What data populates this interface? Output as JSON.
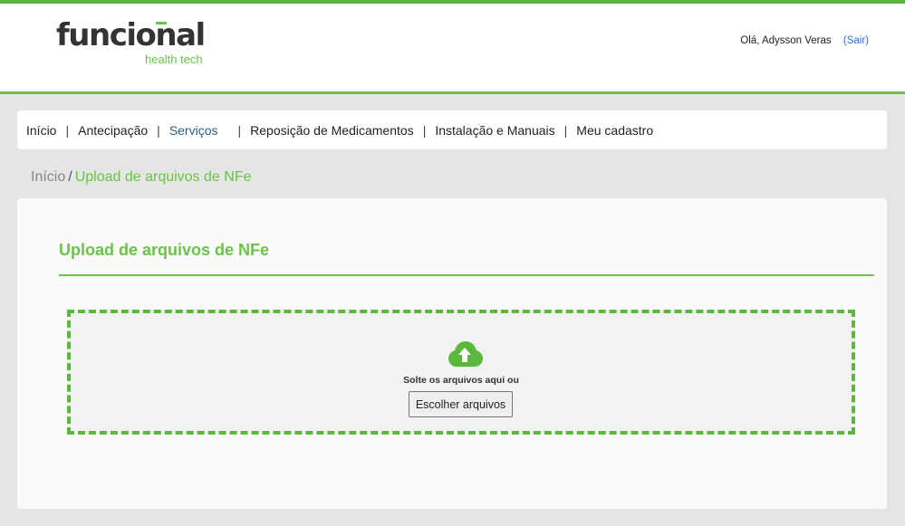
{
  "header": {
    "logo_main": "funcional",
    "logo_sub": "health tech",
    "greeting": "Olá, Adysson Veras",
    "logout_label": "(Sair)"
  },
  "nav": {
    "items": [
      {
        "label": "Início"
      },
      {
        "label": "Antecipação"
      },
      {
        "label": "Serviços"
      },
      {
        "label": "Reposição de Medicamentos"
      },
      {
        "label": "Instalação e Manuais"
      },
      {
        "label": "Meu cadastro"
      }
    ],
    "separator": "|"
  },
  "breadcrumb": {
    "home": "Início",
    "separator": "/",
    "current": "Upload de arquivos de NFe"
  },
  "main": {
    "title": "Upload de arquivos de NFe",
    "dropzone": {
      "icon": "cloud-upload-icon",
      "text": "Solte os arquivos aqui ou",
      "button_label": "Escolher arquivos"
    }
  },
  "colors": {
    "brand_green": "#6cc24a",
    "link_blue": "#2a6fcf"
  }
}
